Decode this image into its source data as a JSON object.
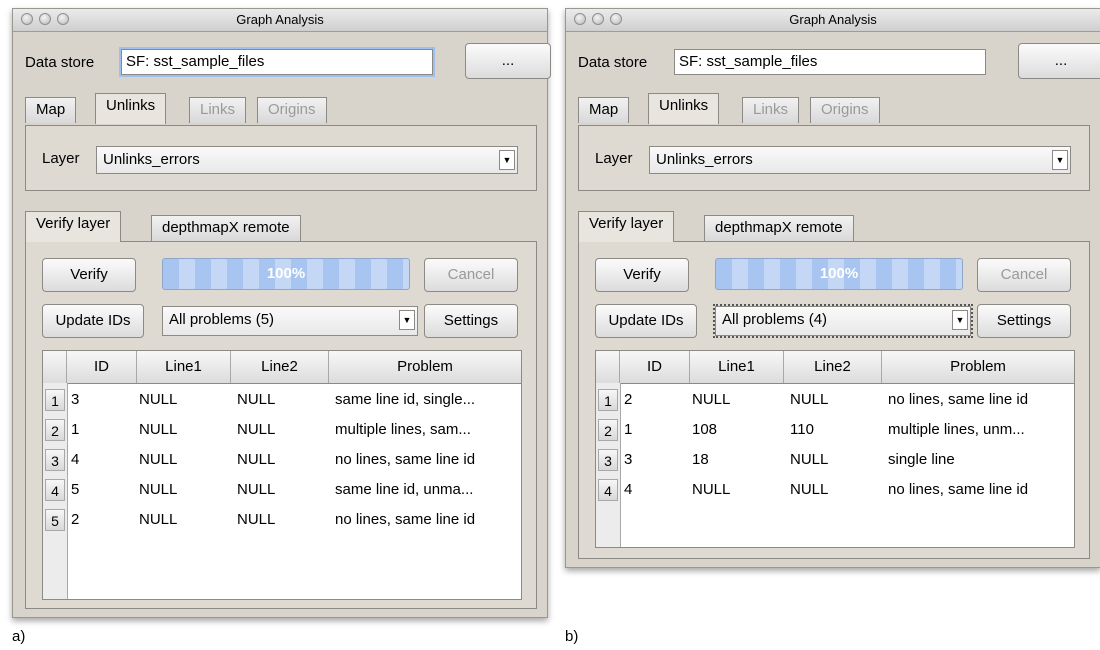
{
  "panels": [
    {
      "caption": "a)",
      "window_title": "Graph Analysis",
      "data_store_label": "Data store",
      "data_store_value": "SF: sst_sample_files",
      "browse_label": "...",
      "top_tabs": [
        {
          "label": "Map",
          "state": "normal"
        },
        {
          "label": "Unlinks",
          "state": "active"
        },
        {
          "label": "Links",
          "state": "disabled"
        },
        {
          "label": "Origins",
          "state": "disabled"
        }
      ],
      "layer_label": "Layer",
      "layer_value": "Unlinks_errors",
      "sub_tabs": [
        {
          "label": "Verify layer",
          "state": "active"
        },
        {
          "label": "depthmapX remote",
          "state": "normal"
        }
      ],
      "verify_label": "Verify",
      "progress_text": "100%",
      "progress": 1.0,
      "cancel_label": "Cancel",
      "update_ids_label": "Update IDs",
      "problems_filter": "All problems (5)",
      "settings_label": "Settings",
      "table": {
        "columns": [
          "ID",
          "Line1",
          "Line2",
          "Problem"
        ],
        "rows": [
          {
            "n": "1",
            "id": "3",
            "line1": "NULL",
            "line2": "NULL",
            "problem": "same line id, single..."
          },
          {
            "n": "2",
            "id": "1",
            "line1": "NULL",
            "line2": "NULL",
            "problem": "multiple lines, sam..."
          },
          {
            "n": "3",
            "id": "4",
            "line1": "NULL",
            "line2": "NULL",
            "problem": "no lines, same line id"
          },
          {
            "n": "4",
            "id": "5",
            "line1": "NULL",
            "line2": "NULL",
            "problem": "same line id, unma..."
          },
          {
            "n": "5",
            "id": "2",
            "line1": "NULL",
            "line2": "NULL",
            "problem": "no lines, same line id"
          }
        ]
      }
    },
    {
      "caption": "b)",
      "window_title": "Graph Analysis",
      "data_store_label": "Data store",
      "data_store_value": "SF: sst_sample_files",
      "browse_label": "...",
      "top_tabs": [
        {
          "label": "Map",
          "state": "normal"
        },
        {
          "label": "Unlinks",
          "state": "active"
        },
        {
          "label": "Links",
          "state": "disabled"
        },
        {
          "label": "Origins",
          "state": "disabled"
        }
      ],
      "layer_label": "Layer",
      "layer_value": "Unlinks_errors",
      "sub_tabs": [
        {
          "label": "Verify layer",
          "state": "active"
        },
        {
          "label": "depthmapX remote",
          "state": "normal"
        }
      ],
      "verify_label": "Verify",
      "progress_text": "100%",
      "progress": 1.0,
      "cancel_label": "Cancel",
      "update_ids_label": "Update IDs",
      "problems_filter": "All problems (4)",
      "settings_label": "Settings",
      "table": {
        "columns": [
          "ID",
          "Line1",
          "Line2",
          "Problem"
        ],
        "rows": [
          {
            "n": "1",
            "id": "2",
            "line1": "NULL",
            "line2": "NULL",
            "problem": "no lines, same line id"
          },
          {
            "n": "2",
            "id": "1",
            "line1": "108",
            "line2": "110",
            "problem": "multiple lines, unm..."
          },
          {
            "n": "3",
            "id": "3",
            "line1": "18",
            "line2": "NULL",
            "problem": "single line"
          },
          {
            "n": "4",
            "id": "4",
            "line1": "NULL",
            "line2": "NULL",
            "problem": "no lines, same line id"
          }
        ]
      }
    }
  ]
}
